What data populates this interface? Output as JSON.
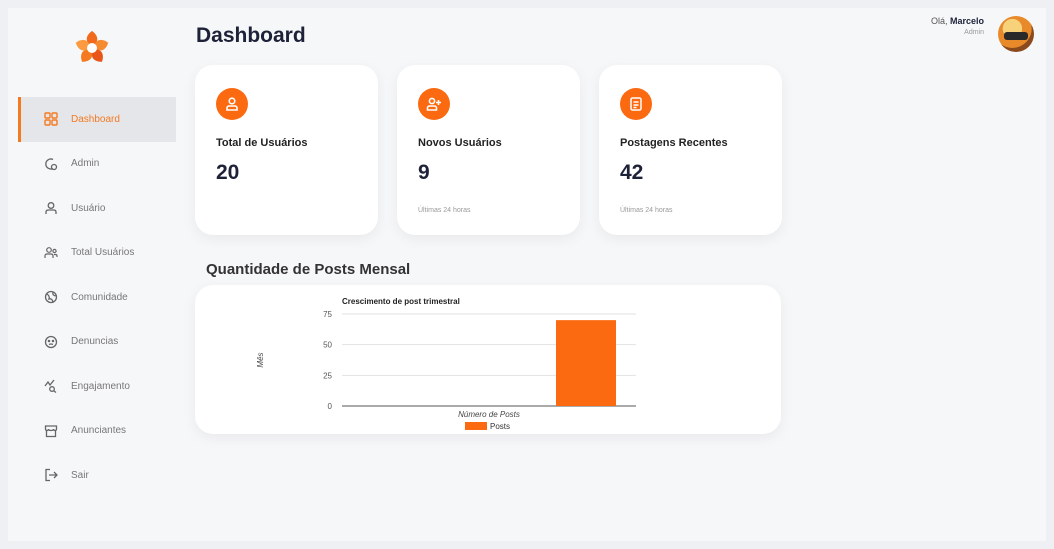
{
  "header": {
    "title": "Dashboard"
  },
  "user": {
    "greeting": "Olá,",
    "name": "Marcelo",
    "role": "Admin"
  },
  "sidebar": {
    "items": [
      {
        "label": "Dashboard",
        "icon": "grid-icon",
        "active": true
      },
      {
        "label": "Admin",
        "icon": "admin-icon"
      },
      {
        "label": "Usuário",
        "icon": "user-icon"
      },
      {
        "label": "Total Usuários",
        "icon": "users-icon"
      },
      {
        "label": "Comunidade",
        "icon": "globe-icon"
      },
      {
        "label": "Denuncias",
        "icon": "face-icon"
      },
      {
        "label": "Engajamento",
        "icon": "trend-icon"
      },
      {
        "label": "Anunciantes",
        "icon": "store-icon"
      },
      {
        "label": "Sair",
        "icon": "logout-icon"
      }
    ]
  },
  "cards": [
    {
      "title": "Total de Usuários",
      "value": "20",
      "sub": "",
      "icon": "user-icon"
    },
    {
      "title": "Novos Usuários",
      "value": "9",
      "sub": "Últimas 24 horas",
      "icon": "user-add-icon"
    },
    {
      "title": "Postagens Recentes",
      "value": "42",
      "sub": "Últimas 24 horas",
      "icon": "post-icon"
    }
  ],
  "section": {
    "title": "Quantidade de Posts Mensal"
  },
  "colors": {
    "accent": "#fb6a10",
    "active_text": "#f47a22"
  },
  "chart_data": {
    "type": "bar",
    "title": "Crescimento de post trimestral",
    "xlabel": "Número de Posts",
    "ylabel": "Mês",
    "ylim": [
      0,
      75
    ],
    "yticks": [
      "75",
      "50",
      "25",
      "0"
    ],
    "categories": [
      ""
    ],
    "series": [
      {
        "name": "Posts",
        "values": [
          70
        ],
        "color": "#fb6a10"
      }
    ],
    "legend": "bottom",
    "grid": true
  }
}
